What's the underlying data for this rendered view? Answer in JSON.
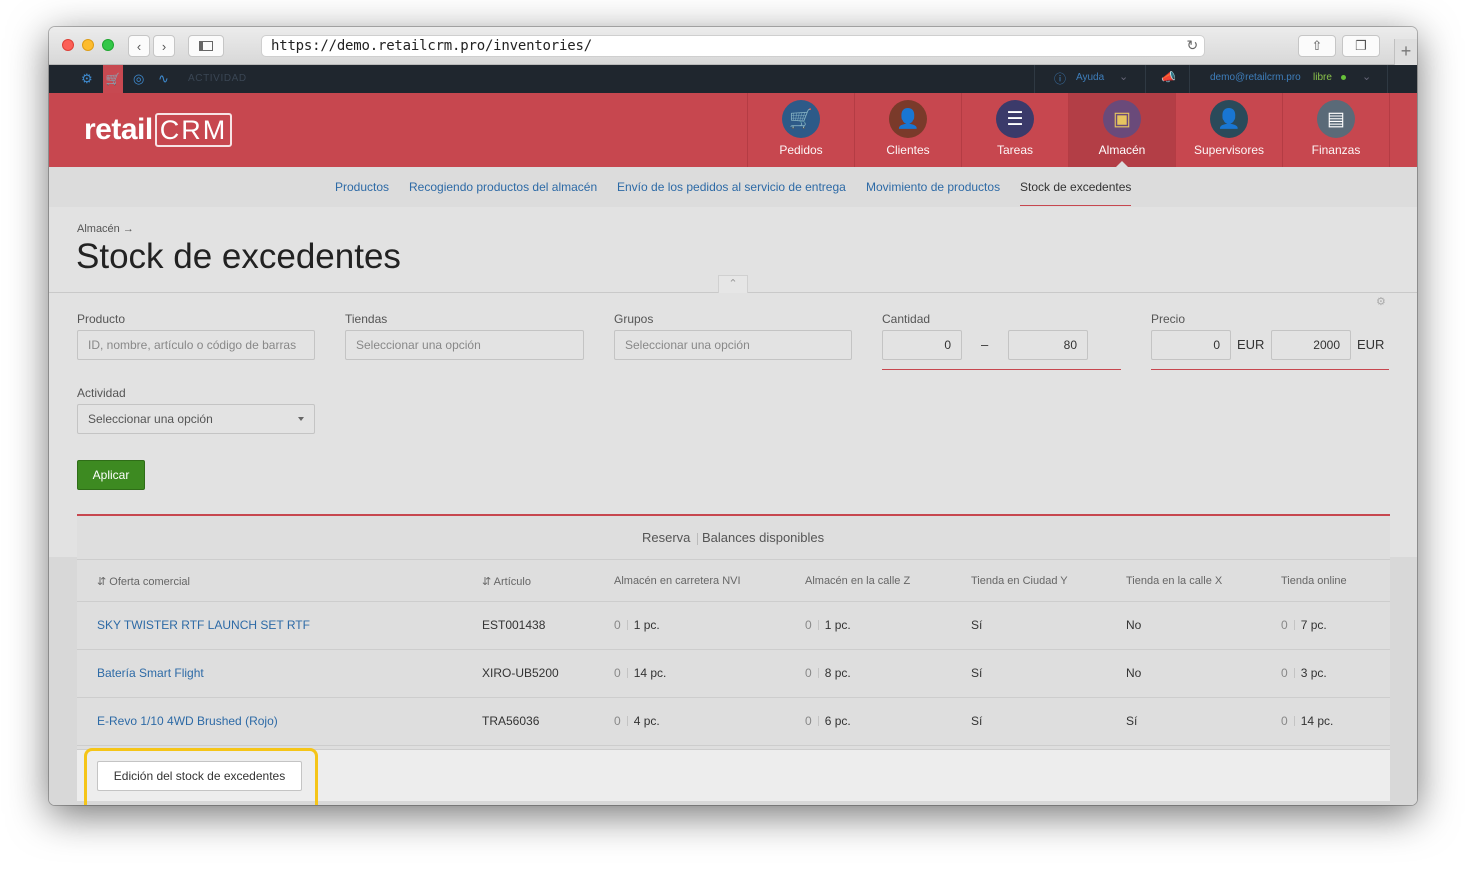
{
  "browser": {
    "url": "https://demo.retailcrm.pro/inventories/",
    "reload_icon": "reload-icon",
    "new_tab": "+"
  },
  "topbar": {
    "activity": "ACTIVIDAD",
    "help": "Ayuda",
    "user_email": "demo@retailcrm.pro",
    "user_status": "libre",
    "status_color": "#67c23a"
  },
  "header": {
    "logo_retail": "retail",
    "logo_crm": "CRM",
    "nav": [
      {
        "label": "Pedidos",
        "icon": "cart-icon",
        "color": "#2d5a88"
      },
      {
        "label": "Clientes",
        "icon": "person-icon",
        "color": "#7a3a2a"
      },
      {
        "label": "Tareas",
        "icon": "chat-list-icon",
        "color": "#3b3a6a"
      },
      {
        "label": "Almacén",
        "icon": "box-icon",
        "color": "#6a4a7a"
      },
      {
        "label": "Supervisores",
        "icon": "supervisor-icon",
        "color": "#2a4a5a"
      },
      {
        "label": "Finanzas",
        "icon": "ledger-icon",
        "color": "#5a6a78"
      }
    ],
    "active_nav": "Almacén"
  },
  "subnav": {
    "items": [
      "Productos",
      "Recogiendo productos del almacén",
      "Envío de los pedidos al servicio de entrega",
      "Movimiento de productos",
      "Stock de excedentes"
    ],
    "current": "Stock de excedentes"
  },
  "page": {
    "breadcrumb": "Almacén →",
    "title": "Stock de excedentes"
  },
  "filters": {
    "producto": {
      "label": "Producto",
      "placeholder": "ID, nombre, artículo o código de barras"
    },
    "tiendas": {
      "label": "Tiendas",
      "placeholder": "Seleccionar una opción"
    },
    "grupos": {
      "label": "Grupos",
      "placeholder": "Seleccionar una opción"
    },
    "cantidad": {
      "label": "Cantidad",
      "min": "0",
      "separator": "–",
      "max": "80"
    },
    "precio": {
      "label": "Precio",
      "min": "0",
      "min_unit": "EUR",
      "max": "2000",
      "max_unit": "EUR"
    },
    "actividad": {
      "label": "Actividad",
      "placeholder": "Seleccionar una opción"
    },
    "apply": "Aplicar"
  },
  "table": {
    "tabs": [
      "Reserva",
      "Balances disponibles"
    ],
    "columns": [
      "Oferta comercial",
      "Artículo",
      "Almacén en carretera NVI",
      "Almacén en la calle Z",
      "Tienda en Ciudad Y",
      "Tienda en la calle X",
      "Tienda online"
    ],
    "rows": [
      {
        "offer": "SKY TWISTER RTF LAUNCH SET RTF",
        "article": "EST001438",
        "nvi_r": "0",
        "nvi_b": "1 pc.",
        "z_r": "0",
        "z_b": "1 pc.",
        "y": "Sí",
        "x": "No",
        "online_r": "0",
        "online_b": "7 pc."
      },
      {
        "offer": "Batería Smart Flight",
        "article": "XIRO-UB5200",
        "nvi_r": "0",
        "nvi_b": "14 pc.",
        "z_r": "0",
        "z_b": "8 pc.",
        "y": "Sí",
        "x": "No",
        "online_r": "0",
        "online_b": "3 pc."
      },
      {
        "offer": "E-Revo 1/10 4WD Brushed (Rojo)",
        "article": "TRA56036",
        "nvi_r": "0",
        "nvi_b": "4 pc.",
        "z_r": "0",
        "z_b": "6 pc.",
        "y": "Sí",
        "x": "Sí",
        "online_r": "0",
        "online_b": "14 pc."
      }
    ]
  },
  "footer": {
    "edit_button": "Edición del stock de excedentes"
  }
}
